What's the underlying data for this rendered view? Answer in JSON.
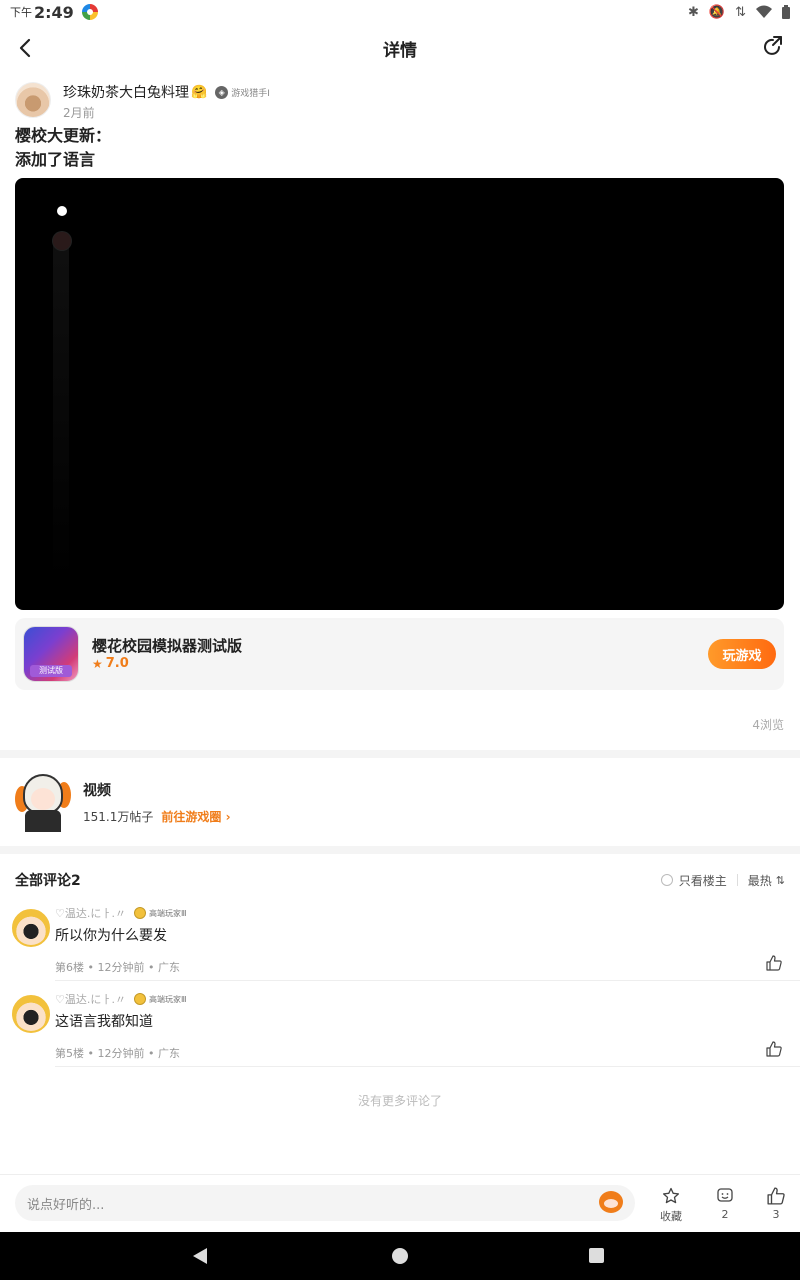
{
  "status_bar": {
    "ampm": "下午",
    "time": "2:49"
  },
  "header": {
    "title": "详情"
  },
  "post": {
    "author_name": "珍珠奶茶大白兔料理",
    "author_emoji": "🤗",
    "author_badge": "游戏猎手I",
    "time_ago": "2月前",
    "text_line1": "樱校大更新：",
    "text_line2": "添加了语言",
    "views": "4浏览"
  },
  "game": {
    "name": "樱花校园模拟器测试版",
    "icon_label": "测试版",
    "rating": "7.0",
    "play_label": "玩游戏"
  },
  "circle": {
    "name": "视频",
    "posts": "151.1万帖子",
    "goto_label": "前往游戏圈"
  },
  "comments_header": {
    "title": "全部评论2",
    "only_op": "只看楼主",
    "sort": "最热"
  },
  "comments": [
    {
      "user": "♡温达.にㅏ.〃",
      "rank": "高端玩家Ⅲ",
      "text": "所以你为什么要发",
      "info": "第6楼 • 12分钟前 • 广东"
    },
    {
      "user": "♡温达.にㅏ.〃",
      "rank": "高端玩家Ⅲ",
      "text": "这语言我都知道",
      "info": "第5楼 • 12分钟前 • 广东"
    }
  ],
  "no_more": "没有更多评论了",
  "bottom_bar": {
    "input_placeholder": "说点好听的...",
    "favorite_label": "收藏",
    "emoji_count": "2",
    "like_count": "3"
  },
  "colors": {
    "accent": "#f07d1a",
    "video_bg": "#000000"
  }
}
